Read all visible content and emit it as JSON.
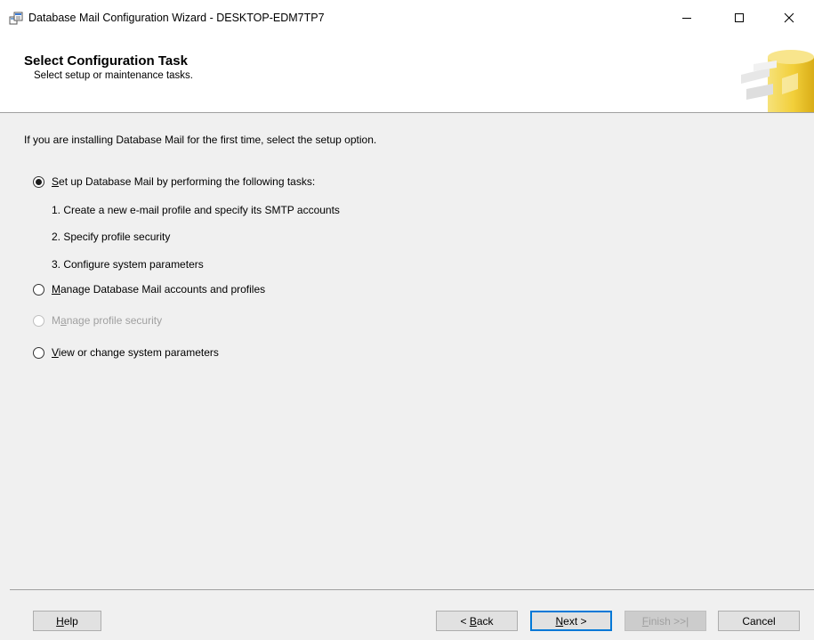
{
  "window": {
    "title": "Database Mail Configuration Wizard - DESKTOP-EDM7TP7",
    "icon": "wizard-icon",
    "controls": [
      "minimize-icon",
      "maximize-icon",
      "close-icon"
    ]
  },
  "header": {
    "title": "Select Configuration Task",
    "subtitle": "Select setup or maintenance tasks.",
    "graphic": "database-icon"
  },
  "main": {
    "intro": "If you are installing Database Mail for the first time, select the setup option.",
    "options": [
      {
        "access_key": "S",
        "rest": "et up Database Mail by performing the following tasks:",
        "checked": true,
        "enabled": true
      },
      {
        "access_key": "M",
        "rest": "anage Database Mail accounts and profiles",
        "checked": false,
        "enabled": true
      },
      {
        "prefix": "M",
        "access_key": "a",
        "rest": "nage profile security",
        "checked": false,
        "enabled": false
      },
      {
        "access_key": "V",
        "rest": "iew or change system parameters",
        "checked": false,
        "enabled": true
      }
    ],
    "tasks": [
      "1. Create a new e-mail profile and specify its SMTP accounts",
      "2. Specify profile security",
      "3. Configure system parameters"
    ]
  },
  "footer": {
    "help": {
      "key": "H",
      "rest": "elp"
    },
    "back": {
      "prefix": "< ",
      "key": "B",
      "rest": "ack"
    },
    "next": {
      "key": "N",
      "rest": "ext >"
    },
    "finish": {
      "key": "F",
      "rest": "inish >>|"
    },
    "cancel": "Cancel"
  },
  "colors": {
    "background": "#f0f0f0",
    "header_background": "#ffffff",
    "default_button_border": "#0078d7",
    "disabled_text": "#a0a0a0"
  }
}
